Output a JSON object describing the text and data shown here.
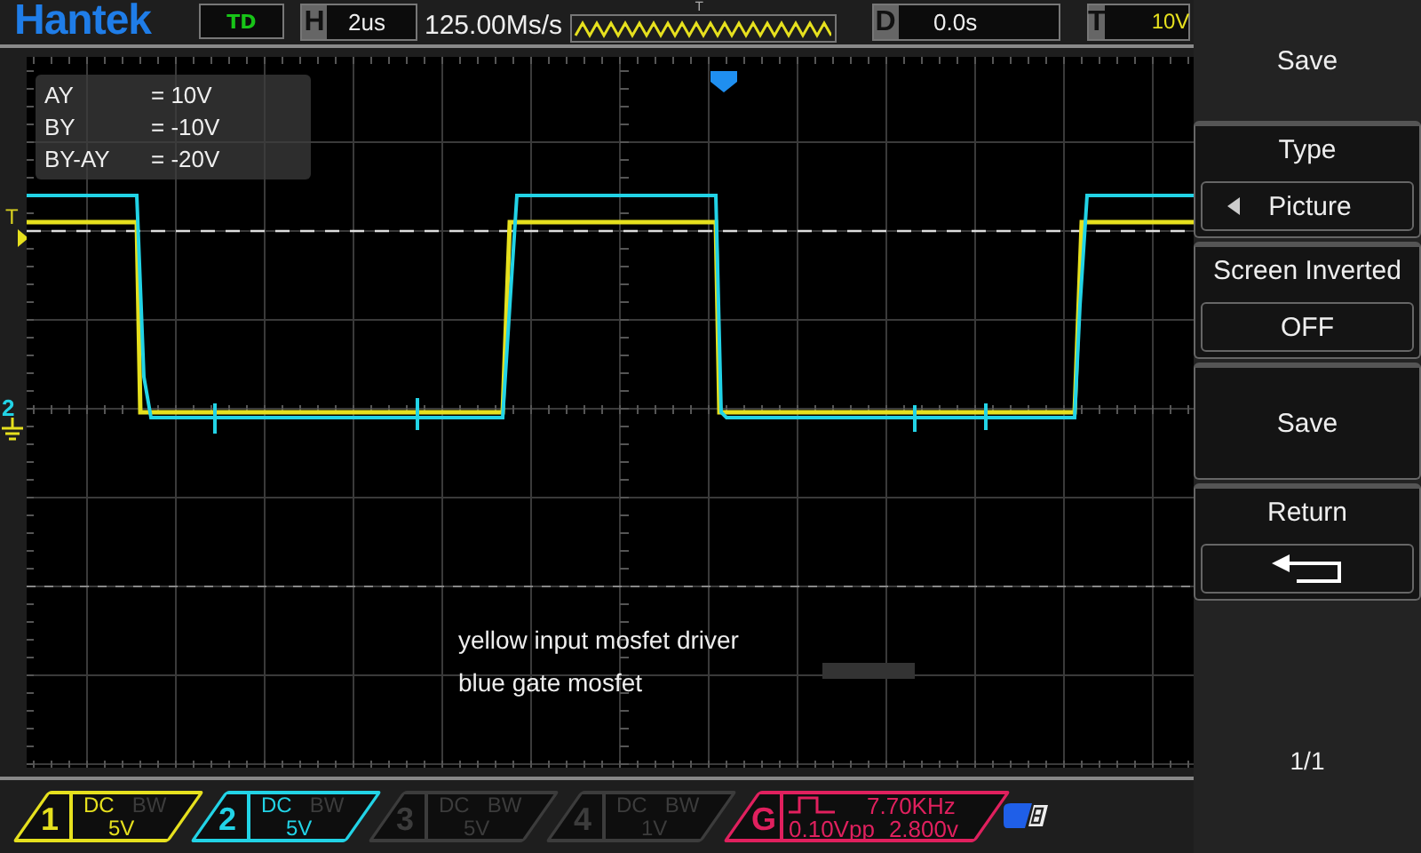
{
  "header": {
    "logo": "Hantek",
    "mode": "TD",
    "timebase": {
      "label": "H",
      "value": "2us"
    },
    "sample_rate": "125.00Ms/s",
    "trigger_position_label": "T",
    "delay": {
      "label": "D",
      "value": "0.0s"
    },
    "trigger": {
      "label": "T",
      "value": "10V"
    }
  },
  "scope": {
    "trigger_level_label": "T",
    "channel_marker": "2",
    "cursor_readout": [
      {
        "label": "AY",
        "value": "= 10V"
      },
      {
        "label": "BY",
        "value": "= -10V"
      },
      {
        "label": "BY-AY",
        "value": "= -20V"
      }
    ],
    "notes": [
      "yellow input mosfet driver",
      "blue gate mosfet"
    ]
  },
  "channels": [
    {
      "number": "1",
      "coupling": "DC",
      "bandwidth": "BW",
      "scale": "5V",
      "enabled": true,
      "color": "#e6e01e"
    },
    {
      "number": "2",
      "coupling": "DC",
      "bandwidth": "BW",
      "scale": "5V",
      "enabled": true,
      "color": "#22d3e6"
    },
    {
      "number": "3",
      "coupling": "DC",
      "bandwidth": "BW",
      "scale": "5V",
      "enabled": false
    },
    {
      "number": "4",
      "coupling": "DC",
      "bandwidth": "BW",
      "scale": "1V",
      "enabled": false
    }
  ],
  "generator": {
    "label": "G",
    "frequency": "7.70KHz",
    "amplitude": "0.10Vpp",
    "offset": "2.800v"
  },
  "menu": {
    "title": "Save",
    "items": [
      {
        "kind": "option",
        "label": "Type",
        "value": "Picture",
        "arrow": true
      },
      {
        "kind": "option",
        "label": "Screen Inverted",
        "value": "OFF",
        "arrow": false
      },
      {
        "kind": "action",
        "label": "Save"
      },
      {
        "kind": "back",
        "label": "Return"
      }
    ],
    "page": "1/1"
  }
}
